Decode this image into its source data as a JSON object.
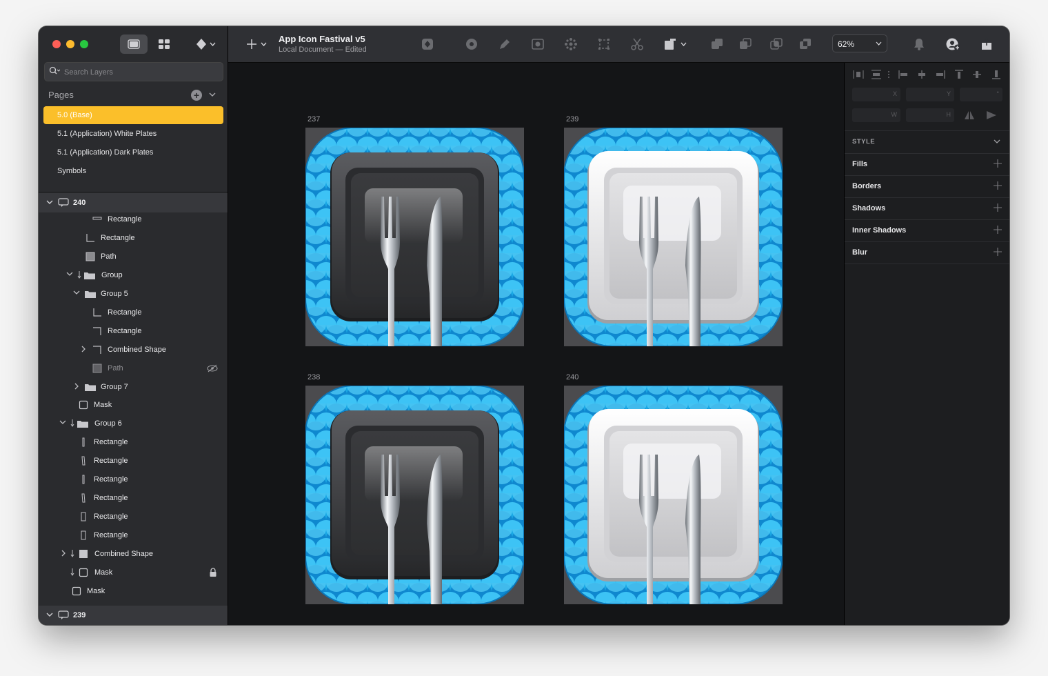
{
  "document": {
    "title": "App Icon Fastival v5",
    "subtitle": "Local Document — Edited"
  },
  "search": {
    "placeholder": "Search Layers"
  },
  "pages": {
    "title": "Pages",
    "items": [
      {
        "label": "5.0 (Base)",
        "selected": true
      },
      {
        "label": "5.1 (Application) White Plates"
      },
      {
        "label": "5.1 (Application) Dark Plates"
      },
      {
        "label": "Symbols"
      }
    ]
  },
  "layers": {
    "group_240": "240",
    "items": [
      "Rectangle",
      "Rectangle",
      "Path",
      "Group",
      "Group 5",
      "Rectangle",
      "Rectangle",
      "Combined Shape",
      "Path",
      "Group 7",
      "Mask",
      "Group 6",
      "Rectangle",
      "Rectangle",
      "Rectangle",
      "Rectangle",
      "Rectangle",
      "Rectangle",
      "Combined Shape",
      "Mask",
      "Mask"
    ],
    "group_239": "239"
  },
  "toolbar": {
    "zoom": "62%"
  },
  "artboards": [
    {
      "label": "237",
      "plate": "dark"
    },
    {
      "label": "239",
      "plate": "white"
    },
    {
      "label": "238",
      "plate": "dark"
    },
    {
      "label": "240",
      "plate": "white"
    }
  ],
  "inspector": {
    "fields": {
      "x": "X",
      "y": "Y",
      "rotation": "°",
      "w": "W",
      "h": "H"
    },
    "style": "STYLE",
    "sections": [
      "Fills",
      "Borders",
      "Shadows",
      "Inner Shadows",
      "Blur"
    ]
  },
  "colors": {
    "accent": "#fbbf2a",
    "icon_blue": "#27b4ec"
  }
}
